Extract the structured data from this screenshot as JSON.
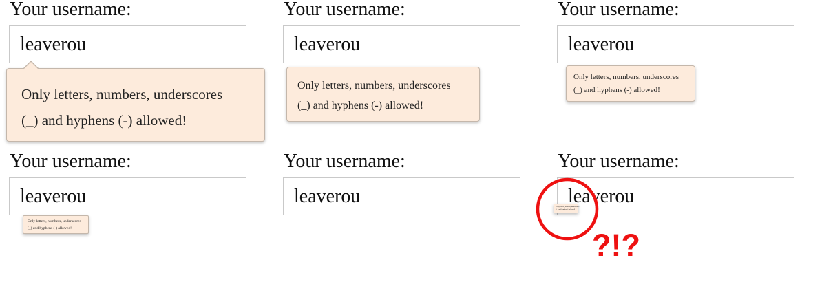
{
  "panels": [
    {
      "label": "Your username:",
      "value": "leaverou",
      "tooltip": [
        "Only letters, numbers, underscores",
        "(_) and hyphens (-) allowed!"
      ]
    },
    {
      "label": "Your username:",
      "value": "leaverou",
      "tooltip": [
        "Only letters, numbers, underscores",
        "(_) and hyphens (-) allowed!"
      ]
    },
    {
      "label": "Your username:",
      "value": "leaverou",
      "tooltip": [
        "Only letters, numbers, underscores",
        "(_) and hyphens (-) allowed!"
      ]
    },
    {
      "label": "Your username:",
      "value": "leaverou",
      "tooltip": [
        "Only letters, numbers, underscores",
        "(_) and hyphens (-) allowed!"
      ]
    },
    {
      "label": "Your username:",
      "value": "leaverou",
      "tooltip": []
    },
    {
      "label": "Your username:",
      "value": "leaverou",
      "tooltip": [
        "Only letters, numbers, underscores",
        "(_) and hyphens (-) allowed!"
      ]
    }
  ],
  "annotation": {
    "text": "?!?",
    "color": "#ee1111"
  },
  "colors": {
    "tooltip_background": "#fdebdc",
    "tooltip_border": "#c4b7ab",
    "field_border": "#c9c9c9"
  }
}
